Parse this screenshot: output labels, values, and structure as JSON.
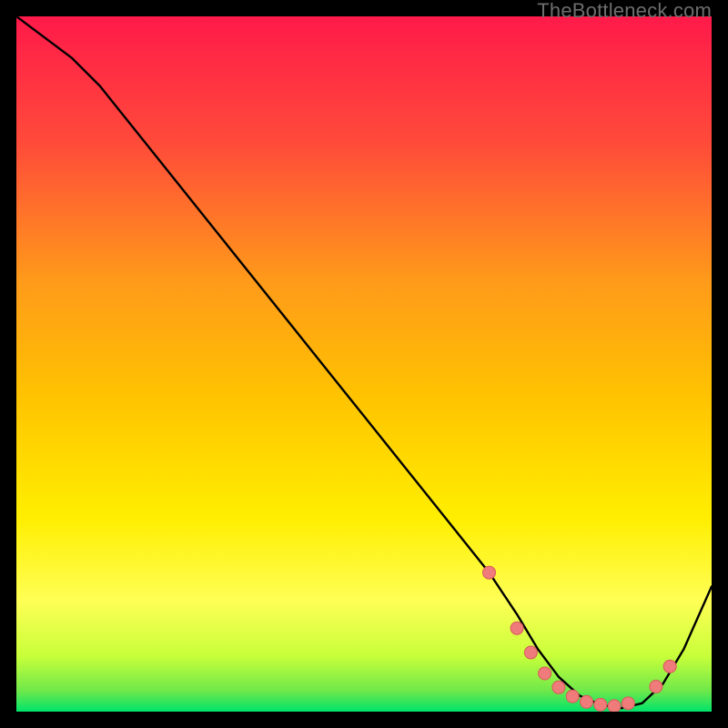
{
  "attribution": "TheBottleneck.com",
  "colors": {
    "top": "#ff1a4a",
    "mid": "#ffc400",
    "low_yellow": "#ffff55",
    "near_bottom": "#c8ff3a",
    "bottom": "#00e36a",
    "curve": "#000000",
    "marker_fill": "#f07b7b",
    "marker_stroke": "#d85a5a",
    "background": "#000000"
  },
  "chart_data": {
    "type": "line",
    "title": "",
    "xlabel": "",
    "ylabel": "",
    "xlim": [
      0,
      100
    ],
    "ylim": [
      0,
      100
    ],
    "curve": {
      "x": [
        0,
        8,
        12,
        20,
        30,
        40,
        50,
        60,
        68,
        72,
        75,
        78,
        81,
        84,
        87,
        90,
        93,
        96,
        100
      ],
      "y": [
        100,
        94,
        90,
        80,
        67.5,
        55,
        42.5,
        30,
        20,
        14,
        9,
        5,
        2.3,
        1,
        0.5,
        1.2,
        4,
        9,
        18
      ]
    },
    "markers": {
      "x": [
        68,
        72,
        74,
        76,
        78,
        80,
        82,
        84,
        86,
        88,
        92,
        94
      ],
      "y": [
        20,
        12,
        8.5,
        5.5,
        3.5,
        2.2,
        1.4,
        1,
        0.8,
        1.2,
        3.6,
        6.5
      ]
    }
  }
}
